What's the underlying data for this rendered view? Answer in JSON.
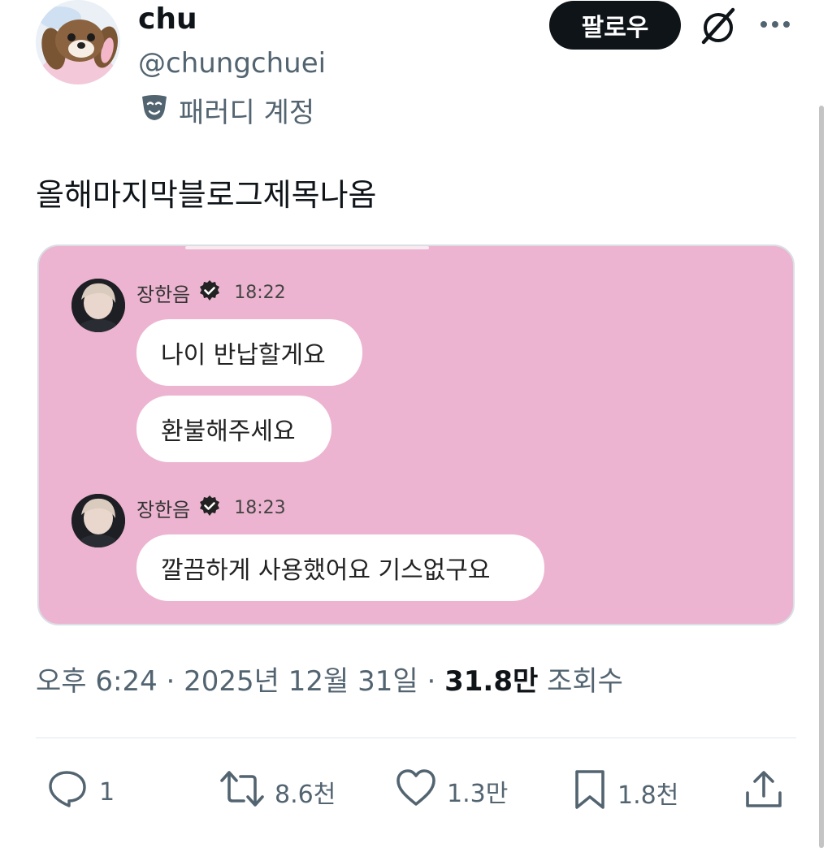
{
  "author": {
    "name": "chu",
    "handle": "@chungchuei",
    "parody_label": "패러디 계정"
  },
  "header": {
    "follow_label": "팔로우"
  },
  "tweet": {
    "text": "올해마지막블로그제목나옴",
    "time": "오후 6:24",
    "date": "2025년 12월 31일",
    "views_count": "31.8만",
    "views_label": "조회수"
  },
  "chat": {
    "messages": [
      {
        "sender": "장한음",
        "time": "18:22",
        "bubbles": [
          "나이 반납할게요",
          "환불해주세요"
        ]
      },
      {
        "sender": "장한음",
        "time": "18:23",
        "bubbles": [
          "깔끔하게 사용했어요 기스없구요"
        ]
      }
    ]
  },
  "actions": {
    "reply_count": "1",
    "retweet_count": "8.6천",
    "like_count": "1.3만",
    "bookmark_count": "1.8천"
  },
  "colors": {
    "card_bg": "#ecb4d0",
    "text_primary": "#0f1419",
    "text_secondary": "#536471"
  }
}
